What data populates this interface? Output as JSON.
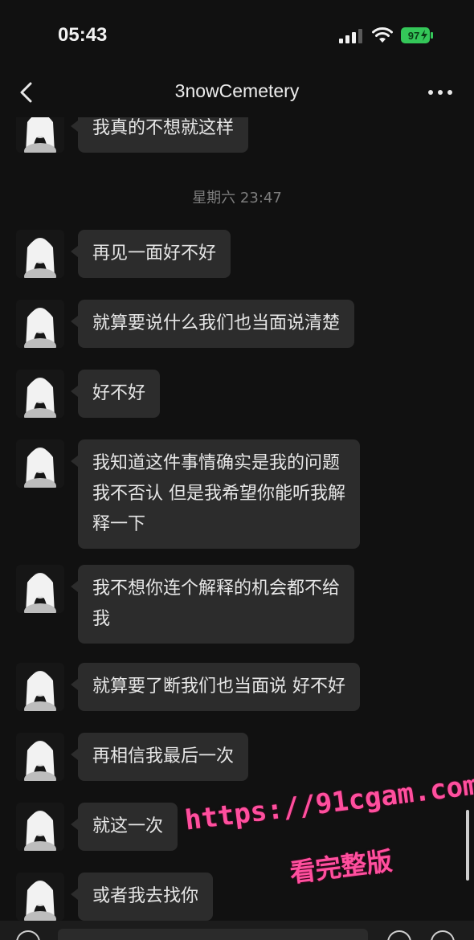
{
  "status_bar": {
    "time": "05:43",
    "battery": "97"
  },
  "header": {
    "title": "3nowCemetery"
  },
  "messages": [
    {
      "text": "我真的不想就这样"
    },
    {
      "timestamp": "星期六 23:47"
    },
    {
      "text": "再见一面好不好"
    },
    {
      "text": "就算要说什么我们也当面说清楚"
    },
    {
      "text": "好不好"
    },
    {
      "lines": [
        "我知道这件事情确实是我的问题",
        "我不否认 但是我希望你能听我解",
        "释一下"
      ]
    },
    {
      "lines": [
        "我不想你连个解释的机会都不给",
        "我"
      ]
    },
    {
      "text": "就算要了断我们也当面说 好不好"
    },
    {
      "text": "再相信我最后一次"
    },
    {
      "text": "就这一次"
    },
    {
      "text": "或者我去找你"
    }
  ],
  "watermark": {
    "url": "https://91cgam.com",
    "sub": "看完整版"
  },
  "colors": {
    "background": "#111111",
    "bubble": "#2c2c2c",
    "battery": "#34c759",
    "watermark": "#ff4f9e"
  }
}
